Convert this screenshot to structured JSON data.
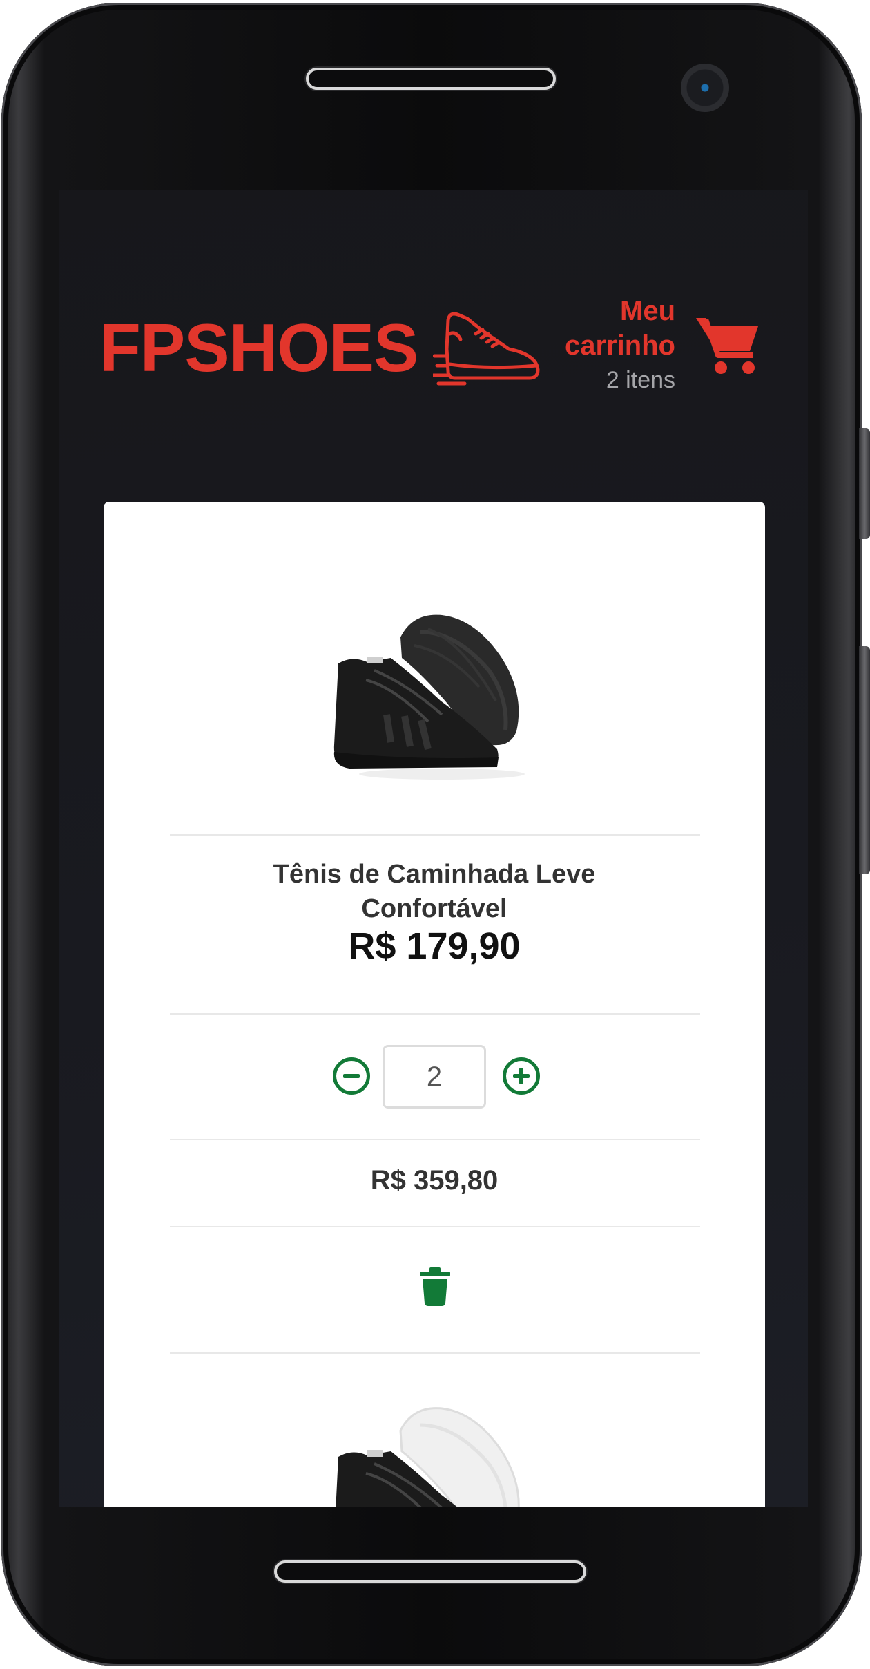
{
  "app": {
    "brand": "FPSHOES",
    "brand_color": "#e2362c",
    "accent_color": "#127a37"
  },
  "header": {
    "cart_label": "Meu carrinho",
    "cart_count": "2 itens",
    "cart_icon": "cart-icon",
    "logo_icon": "running-shoe-icon"
  },
  "cart": {
    "items": [
      {
        "title": "Tênis de Caminhada Leve Confortável",
        "unit_price": "R$ 179,90",
        "quantity": "2",
        "subtotal": "R$ 359,80",
        "image": "black-sneaker",
        "decrement_icon": "minus-circle-icon",
        "increment_icon": "plus-circle-icon",
        "remove_icon": "trash-icon"
      },
      {
        "image": "black-white-sneaker"
      }
    ]
  }
}
